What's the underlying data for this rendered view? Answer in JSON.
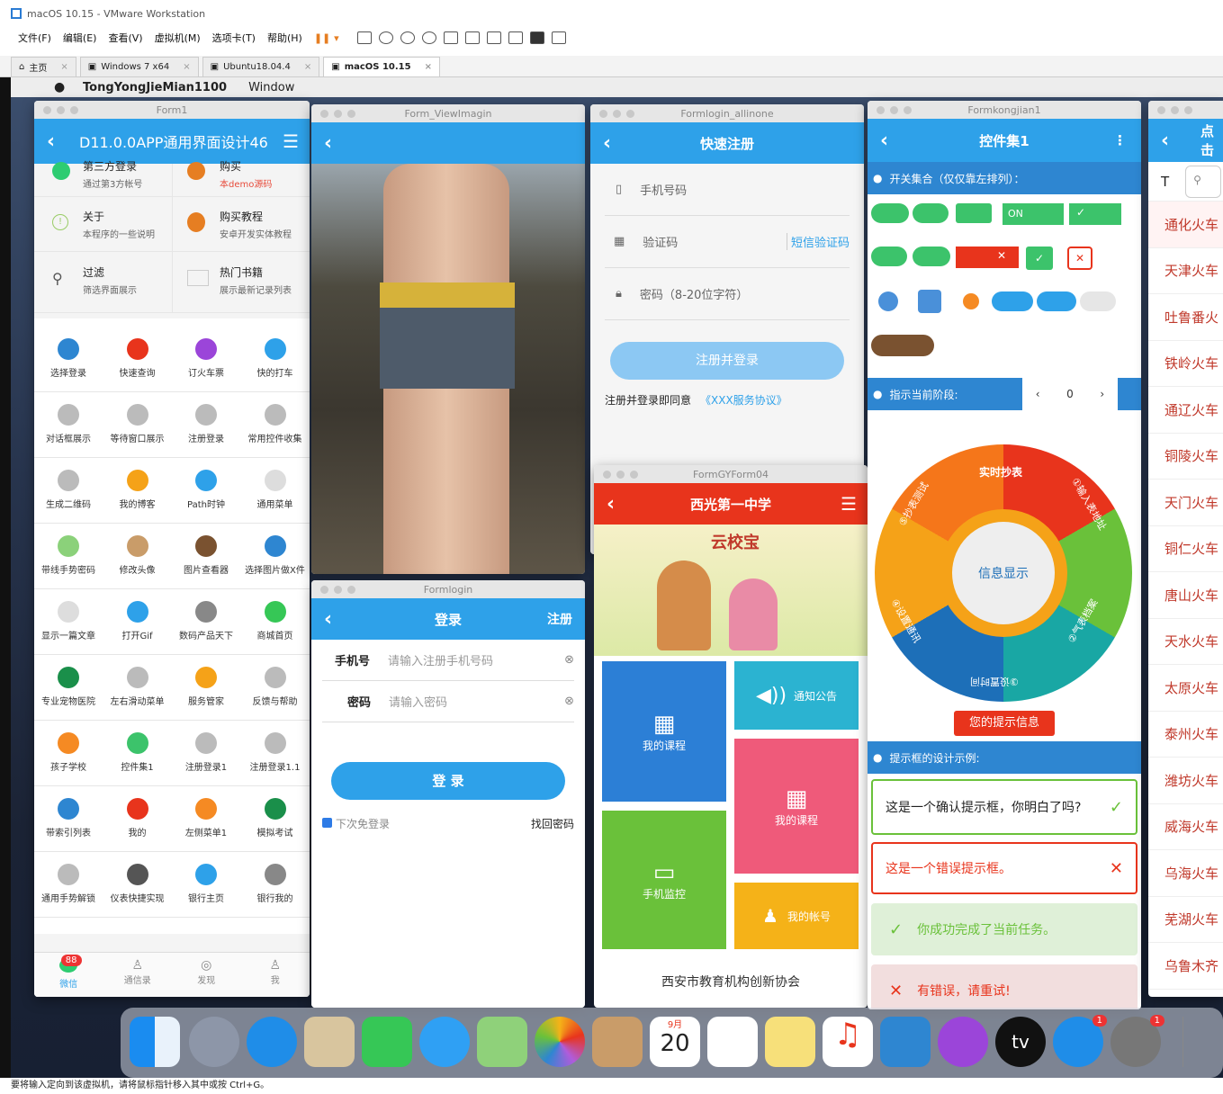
{
  "vm": {
    "title": "macOS 10.15 - VMware Workstation",
    "menus": [
      "文件(F)",
      "编辑(E)",
      "查看(V)",
      "虚拟机(M)",
      "选项卡(T)",
      "帮助(H)"
    ],
    "tabs": [
      "主页",
      "Windows 7 x64",
      "Ubuntu18.04.4",
      "macOS 10.15"
    ],
    "status": "要将输入定向到该虚拟机，请将鼠标指针移入其中或按 Ctrl+G。"
  },
  "mac": {
    "app": "TongYongJieMian1100",
    "menu": "Window"
  },
  "form1": {
    "wtitle": "Form1",
    "header": "D11.0.0APP通用界面设计46",
    "top_rows": [
      {
        "t1": "第三方登录",
        "t2": "通过第3方帐号"
      },
      {
        "t1": "购买",
        "t2": "本demo源码"
      },
      {
        "t1": "关于",
        "t2": "本程序的一些说明"
      },
      {
        "t1": "购买教程",
        "t2": "安卓开发实体教程"
      },
      {
        "t1": "过滤",
        "t2": "筛选界面展示"
      },
      {
        "t1": "热门书籍",
        "t2": "展示最新记录列表"
      }
    ],
    "grid": [
      "选择登录",
      "快速查询",
      "订火车票",
      "快的打车",
      "对话框展示",
      "等待窗口展示",
      "注册登录",
      "常用控件收集",
      "生成二维码",
      "我的博客",
      "Path时钟",
      "通用菜单",
      "带线手势密码",
      "修改头像",
      "图片查看器",
      "选择图片做X件",
      "显示一篇文章",
      "打开Gif",
      "数码产品天下",
      "商城首页",
      "专业宠物医院",
      "左右滑动菜单",
      "服务管家",
      "反馈与帮助",
      "孩子学校",
      "控件集1",
      "注册登录1",
      "注册登录1.1",
      "带索引列表",
      "我的",
      "左侧菜单1",
      "模拟考试",
      "通用手势解锁",
      "仪表快捷实现",
      "银行主页",
      "银行我的"
    ],
    "tabs": [
      "微信",
      "通信录",
      "发现",
      "我"
    ],
    "badge": "88"
  },
  "viewimg": {
    "wtitle": "Form_ViewImagin"
  },
  "reg": {
    "wtitle": "Formlogin_allinone",
    "header": "快速注册",
    "phone": "手机号码",
    "code": "验证码",
    "sms": "短信验证码",
    "pwd": "密码（8-20位字符）",
    "btn": "注册并登录",
    "agree": "注册并登录即同意",
    "protocol": "《XXX服务协议》"
  },
  "login": {
    "wtitle": "Formlogin",
    "header": "登录",
    "register": "注册",
    "phone_label": "手机号",
    "phone_ph": "请输入注册手机号码",
    "pwd_label": "密码",
    "pwd_ph": "请输入密码",
    "btn": "登 录",
    "remember": "下次免登录",
    "forgot": "找回密码"
  },
  "school": {
    "wtitle": "FormGYForm04",
    "header": "西光第一中学",
    "banner": "云校宝",
    "tiles": [
      "我的课程",
      "通知公告",
      "我的课程",
      "手机监控",
      "我的帐号"
    ],
    "footer": "西安市教育机构创新协会"
  },
  "ctrl": {
    "wtitle": "Formkongjian1",
    "header": "控件集1",
    "sec1": "开关集合（仅仅靠左排列）：",
    "on": "ON",
    "sec2": "指示当前阶段:",
    "stepper": "0",
    "wheel": [
      "实时抄表",
      "①输入表地址",
      "②气表档案",
      "③设置时间",
      "④设置通讯",
      "⑤抄表测试"
    ],
    "center": "信息显示",
    "hint": "您的提示信息",
    "sec3": "提示框的设计示例:",
    "confirm": "这是一个确认提示框，你明白了吗?",
    "error": "这是一个错误提示框。",
    "success": "你成功完成了当前任务。",
    "retry": "有错误，请重试!"
  },
  "trains": {
    "header": "点击",
    "items": [
      "通化火车",
      "天津火车",
      "吐鲁番火",
      "铁岭火车",
      "通辽火车",
      "铜陵火车",
      "天门火车",
      "铜仁火车",
      "唐山火车",
      "天水火车",
      "太原火车",
      "泰州火车",
      "潍坊火车",
      "威海火车",
      "乌海火车",
      "芜湖火车",
      "乌鲁木齐"
    ]
  },
  "dock": {
    "calendar_month": "9月",
    "calendar_day": "20",
    "badge1": "1",
    "badge2": "1",
    "tv": "tv"
  }
}
